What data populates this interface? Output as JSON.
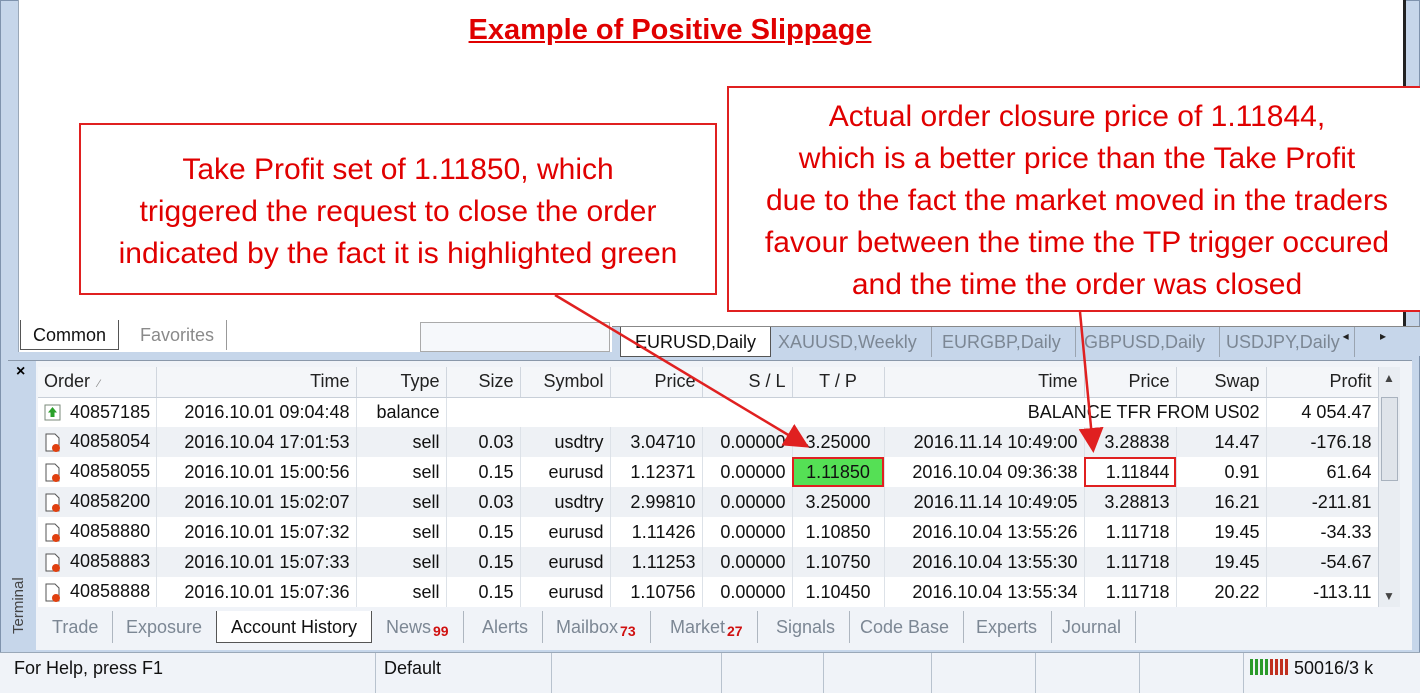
{
  "title": "Example of Positive Slippage",
  "callouts": {
    "left": [
      "Take Profit set of 1.11850, which",
      "triggered the request to close the order",
      "indicated by the fact it is highlighted green"
    ],
    "right": [
      "Actual order closure price of 1.11844,",
      "which is a better price than the Take Profit",
      "due to the fact the market moved in the traders",
      "favour between the time the TP trigger occured",
      "and the time the order was closed"
    ]
  },
  "navigator_tabs": [
    "Common",
    "Favorites"
  ],
  "chart_tabs": [
    "EURUSD,Daily",
    "XAUUSD,Weekly",
    "EURGBP,Daily",
    "GBPUSD,Daily",
    "USDJPY,Daily"
  ],
  "chart_tab_arrows": "◂ ▸",
  "terminal": {
    "close_glyph": "×",
    "side_label": "Terminal",
    "columns": [
      "Order",
      "Time",
      "Type",
      "Size",
      "Symbol",
      "Price",
      "S / L",
      "T / P",
      "Time",
      "Price",
      "Swap",
      "Profit"
    ],
    "sort_glyph": "⁄",
    "rows": [
      {
        "icon": "balance-icon",
        "order": "40857185",
        "time": "2016.10.01 09:04:48",
        "type": "balance",
        "comment": "BALANCE TFR FROM US02",
        "profit": "4 054.47"
      },
      {
        "icon": "order-icon",
        "order": "40858054",
        "time": "2016.10.04 17:01:53",
        "type": "sell",
        "size": "0.03",
        "symbol": "usdtry",
        "price": "3.04710",
        "sl": "0.00000",
        "tp": "3.25000",
        "close_time": "2016.11.14 10:49:00",
        "close_price": "3.28838",
        "swap": "14.47",
        "profit": "-176.18"
      },
      {
        "icon": "order-icon",
        "order": "40858055",
        "time": "2016.10.01 15:00:56",
        "type": "sell",
        "size": "0.15",
        "symbol": "eurusd",
        "price": "1.12371",
        "sl": "0.00000",
        "tp": "1.11850",
        "close_time": "2016.10.04 09:36:38",
        "close_price": "1.11844",
        "swap": "0.91",
        "profit": "61.64"
      },
      {
        "icon": "order-icon",
        "order": "40858200",
        "time": "2016.10.01 15:02:07",
        "type": "sell",
        "size": "0.03",
        "symbol": "usdtry",
        "price": "2.99810",
        "sl": "0.00000",
        "tp": "3.25000",
        "close_time": "2016.11.14 10:49:05",
        "close_price": "3.28813",
        "swap": "16.21",
        "profit": "-211.81"
      },
      {
        "icon": "order-icon",
        "order": "40858880",
        "time": "2016.10.01 15:07:32",
        "type": "sell",
        "size": "0.15",
        "symbol": "eurusd",
        "price": "1.11426",
        "sl": "0.00000",
        "tp": "1.10850",
        "close_time": "2016.10.04 13:55:26",
        "close_price": "1.11718",
        "swap": "19.45",
        "profit": "-34.33"
      },
      {
        "icon": "order-icon",
        "order": "40858883",
        "time": "2016.10.01 15:07:33",
        "type": "sell",
        "size": "0.15",
        "symbol": "eurusd",
        "price": "1.11253",
        "sl": "0.00000",
        "tp": "1.10750",
        "close_time": "2016.10.04 13:55:30",
        "close_price": "1.11718",
        "swap": "19.45",
        "profit": "-54.67"
      },
      {
        "icon": "order-icon",
        "order": "40858888",
        "time": "2016.10.01 15:07:36",
        "type": "sell",
        "size": "0.15",
        "symbol": "eurusd",
        "price": "1.10756",
        "sl": "0.00000",
        "tp": "1.10450",
        "close_time": "2016.10.04 13:55:34",
        "close_price": "1.11718",
        "swap": "20.22",
        "profit": "-113.11"
      }
    ],
    "tabs": [
      {
        "label": "Trade",
        "badge": ""
      },
      {
        "label": "Exposure",
        "badge": ""
      },
      {
        "label": "Account History",
        "badge": ""
      },
      {
        "label": "News",
        "badge": "99"
      },
      {
        "label": "Alerts",
        "badge": ""
      },
      {
        "label": "Mailbox",
        "badge": "73"
      },
      {
        "label": "Market",
        "badge": "27"
      },
      {
        "label": "Signals",
        "badge": ""
      },
      {
        "label": "Code Base",
        "badge": ""
      },
      {
        "label": "Experts",
        "badge": ""
      },
      {
        "label": "Journal",
        "badge": ""
      }
    ],
    "active_tab": "Account History"
  },
  "status_bar": {
    "help": "For Help, press F1",
    "profile": "Default",
    "connection": "50016/3 k"
  },
  "colors": {
    "annotation_red": "#e00000",
    "tp_highlight_green": "#55e055"
  }
}
